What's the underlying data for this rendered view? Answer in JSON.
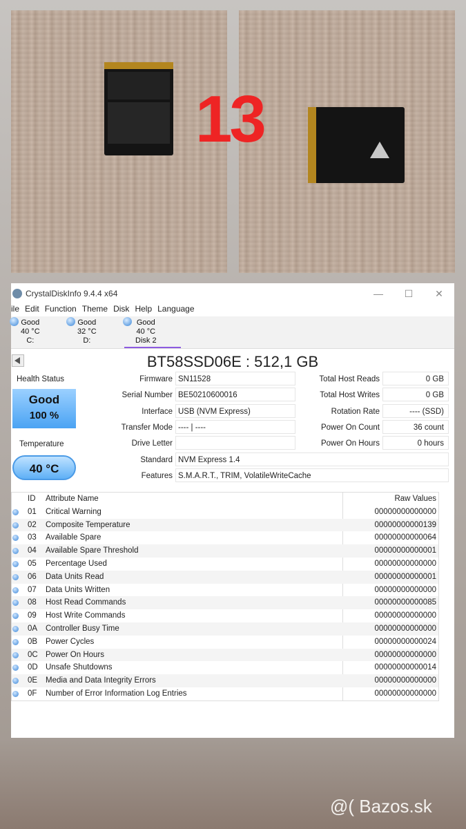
{
  "overlay_number": "13",
  "watermark": "@( Bazos.sk",
  "window": {
    "title": "CrystalDiskInfo 9.4.4 x64"
  },
  "menu": [
    "ile",
    "Edit",
    "Function",
    "Theme",
    "Disk",
    "Help",
    "Language"
  ],
  "drives": [
    {
      "status": "Good",
      "temp": "40 °C",
      "label": "C:"
    },
    {
      "status": "Good",
      "temp": "32 °C",
      "label": "D:"
    },
    {
      "status": "Good",
      "temp": "40 °C",
      "label": "Disk 2"
    }
  ],
  "disk_title": "BT58SSD06E : 512,1 GB",
  "health": {
    "label": "Health Status",
    "status": "Good",
    "percent": "100 %"
  },
  "temperature": {
    "label": "Temperature",
    "value": "40 °C"
  },
  "info": {
    "firmware": {
      "label": "Firmware",
      "value": "SN11528"
    },
    "serial": {
      "label": "Serial Number",
      "value": "BE50210600016"
    },
    "interface": {
      "label": "Interface",
      "value": "USB (NVM Express)"
    },
    "transfer": {
      "label": "Transfer Mode",
      "value": "---- | ----"
    },
    "drive_letter": {
      "label": "Drive Letter",
      "value": ""
    },
    "standard": {
      "label": "Standard",
      "value": "NVM Express 1.4"
    },
    "features": {
      "label": "Features",
      "value": "S.M.A.R.T., TRIM, VolatileWriteCache"
    },
    "host_reads": {
      "label": "Total Host Reads",
      "value": "0 GB"
    },
    "host_writes": {
      "label": "Total Host Writes",
      "value": "0 GB"
    },
    "rotation": {
      "label": "Rotation Rate",
      "value": "---- (SSD)"
    },
    "power_count": {
      "label": "Power On Count",
      "value": "36 count"
    },
    "power_hours": {
      "label": "Power On Hours",
      "value": "0 hours"
    }
  },
  "smart": {
    "headers": {
      "id": "ID",
      "name": "Attribute Name",
      "raw": "Raw Values"
    },
    "rows": [
      {
        "id": "01",
        "name": "Critical Warning",
        "raw": "00000000000000"
      },
      {
        "id": "02",
        "name": "Composite Temperature",
        "raw": "00000000000139"
      },
      {
        "id": "03",
        "name": "Available Spare",
        "raw": "00000000000064"
      },
      {
        "id": "04",
        "name": "Available Spare Threshold",
        "raw": "00000000000001"
      },
      {
        "id": "05",
        "name": "Percentage Used",
        "raw": "00000000000000"
      },
      {
        "id": "06",
        "name": "Data Units Read",
        "raw": "00000000000001"
      },
      {
        "id": "07",
        "name": "Data Units Written",
        "raw": "00000000000000"
      },
      {
        "id": "08",
        "name": "Host Read Commands",
        "raw": "00000000000085"
      },
      {
        "id": "09",
        "name": "Host Write Commands",
        "raw": "00000000000000"
      },
      {
        "id": "0A",
        "name": "Controller Busy Time",
        "raw": "00000000000000"
      },
      {
        "id": "0B",
        "name": "Power Cycles",
        "raw": "00000000000024"
      },
      {
        "id": "0C",
        "name": "Power On Hours",
        "raw": "00000000000000"
      },
      {
        "id": "0D",
        "name": "Unsafe Shutdowns",
        "raw": "00000000000014"
      },
      {
        "id": "0E",
        "name": "Media and Data Integrity Errors",
        "raw": "00000000000000"
      },
      {
        "id": "0F",
        "name": "Number of Error Information Log Entries",
        "raw": "00000000000000"
      }
    ]
  }
}
